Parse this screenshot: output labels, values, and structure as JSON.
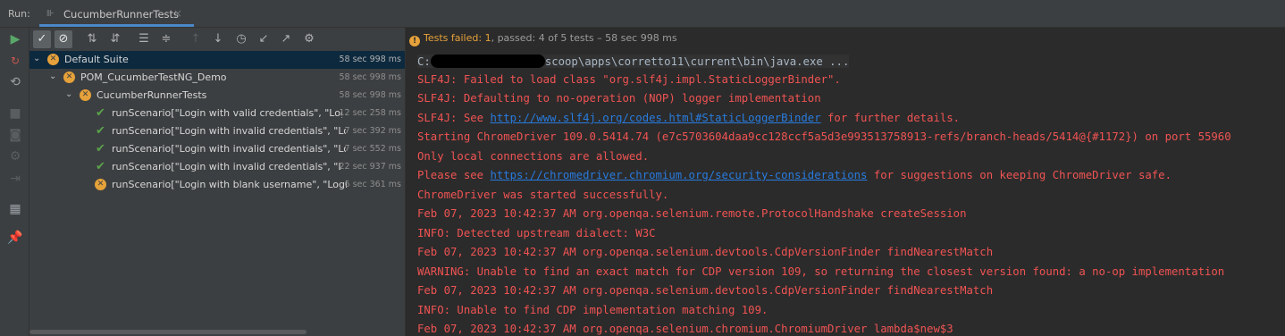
{
  "run_bar": {
    "label": "Run:",
    "tab_title": "CucumberRunnerTests",
    "close": "×"
  },
  "toolbar": {
    "icons": [
      "run-icon",
      "show-passed-icon",
      "show-ignored-icon",
      "sort-alpha-icon",
      "sort-duration-icon",
      "expand-all-icon",
      "collapse-all-icon",
      "prev-failed-icon",
      "next-failed-icon",
      "history-icon",
      "import-icon",
      "export-icon",
      "settings-icon"
    ]
  },
  "status": {
    "prefix": "Tests failed: ",
    "failed": "1",
    "middle": ", passed: ",
    "passed": "4",
    "suffix": " of 5 tests – 58 sec 998 ms"
  },
  "tree": [
    {
      "name": "Default Suite",
      "time": "58 sec 998 ms",
      "status": "fail",
      "selected": true
    },
    {
      "name": "POM_CucumberTestNG_Demo",
      "time": "58 sec 998 ms",
      "status": "fail"
    },
    {
      "name": "CucumberRunnerTests",
      "time": "58 sec 998 ms",
      "status": "fail"
    },
    {
      "name": "runScenario[\"Login with valid credentials\", \"Login",
      "time": "12 sec 258 ms",
      "status": "pass"
    },
    {
      "name": "runScenario[\"Login with invalid credentials\", \"Logir",
      "time": "7 sec 392 ms",
      "status": "pass"
    },
    {
      "name": "runScenario[\"Login with invalid credentials\", \"Logir",
      "time": "7 sec 552 ms",
      "status": "pass"
    },
    {
      "name": "runScenario[\"Login with invalid credentials\", \"Log",
      "time": "22 sec 937 ms",
      "status": "pass"
    },
    {
      "name": "runScenario[\"Login with blank username\", \"Login t",
      "time": "6 sec 361 ms",
      "status": "fail"
    }
  ],
  "console": {
    "cmd_prefix": "C:",
    "cmd_suffix": "scoop\\apps\\corretto11\\current\\bin\\java.exe ...",
    "l1": "SLF4J: Failed to load class \"org.slf4j.impl.StaticLoggerBinder\".",
    "l2": "SLF4J: Defaulting to no-operation (NOP) logger implementation",
    "l3_pre": "SLF4J: See ",
    "l3_link": "http://www.slf4j.org/codes.html#StaticLoggerBinder",
    "l3_post": " for further details.",
    "l4": "Starting ChromeDriver 109.0.5414.74 (e7c5703604daa9cc128ccf5a5d3e993513758913-refs/branch-heads/5414@{#1172}) on port 55960",
    "l5": "Only local connections are allowed.",
    "l6_pre": "Please see ",
    "l6_link": "https://chromedriver.chromium.org/security-considerations",
    "l6_post": " for suggestions on keeping ChromeDriver safe.",
    "l7": "ChromeDriver was started successfully.",
    "l8": "Feb 07, 2023 10:42:37 AM org.openqa.selenium.remote.ProtocolHandshake createSession",
    "l9": "INFO: Detected upstream dialect: W3C",
    "l10": "Feb 07, 2023 10:42:37 AM org.openqa.selenium.devtools.CdpVersionFinder findNearestMatch",
    "l11": "WARNING: Unable to find an exact match for CDP version 109, so returning the closest version found: a no-op implementation",
    "l12": "Feb 07, 2023 10:42:37 AM org.openqa.selenium.devtools.CdpVersionFinder findNearestMatch",
    "l13": "INFO: Unable to find CDP implementation matching 109.",
    "l14": "Feb 07, 2023 10:42:37 AM org.openqa.selenium.chromium.ChromiumDriver lambda$new$3"
  },
  "colors": {
    "error_text": "#f05353",
    "link": "#287bde",
    "fail": "#e5a13a",
    "pass": "#5aa34b",
    "selected": "#0d293e"
  }
}
